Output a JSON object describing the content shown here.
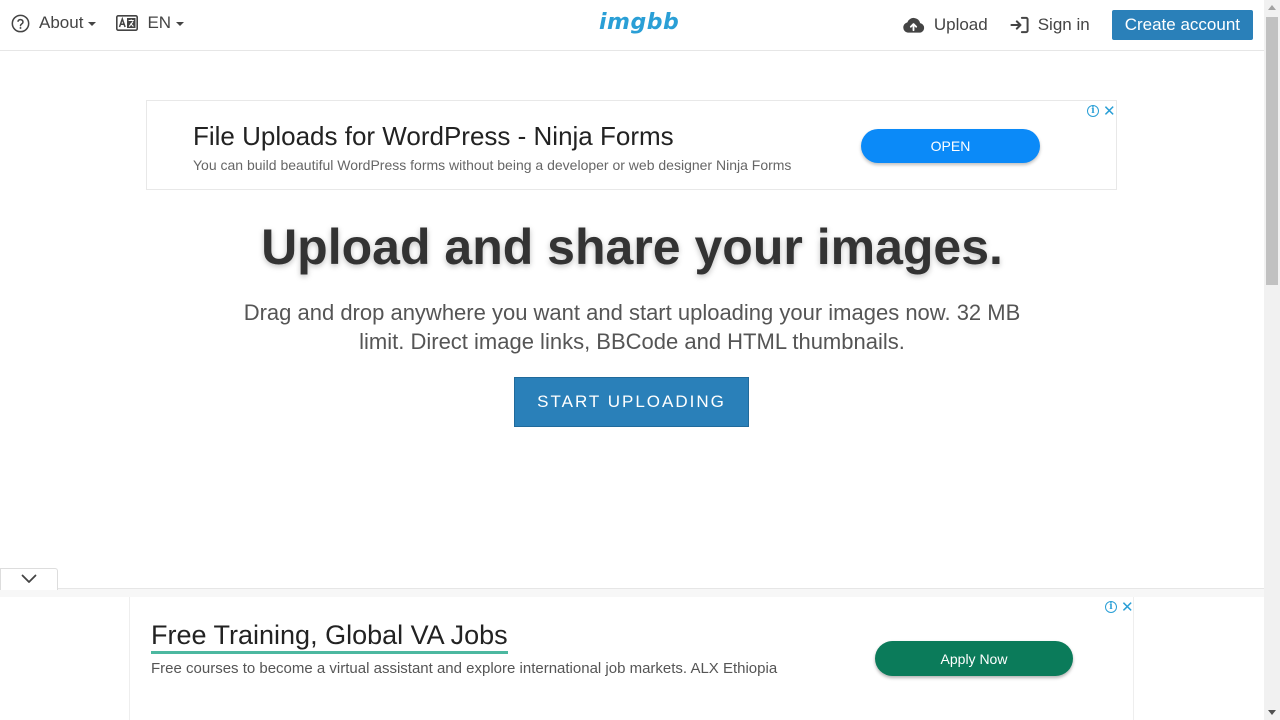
{
  "header": {
    "about_label": "About",
    "language_label": "EN",
    "logo_text": "imgbb",
    "upload_label": "Upload",
    "signin_label": "Sign in",
    "create_account_label": "Create account"
  },
  "ad_top": {
    "title": "File Uploads for WordPress - Ninja Forms",
    "description": "You can build beautiful WordPress forms without being a developer or web designer Ninja Forms",
    "cta_label": "OPEN",
    "info_glyph": "i",
    "close_glyph": "✕"
  },
  "hero": {
    "title": "Upload and share your images.",
    "description": "Drag and drop anywhere you want and start uploading your images now. 32 MB limit. Direct image links, BBCode and HTML thumbnails.",
    "start_label": "START UPLOADING"
  },
  "ad_bottom": {
    "title": "Free Training, Global VA Jobs",
    "description": "Free courses to become a virtual assistant and explore international job markets. ALX Ethiopia",
    "cta_label": "Apply Now",
    "info_glyph": "i",
    "close_glyph": "✕"
  },
  "icons": {
    "help": "question-circle-icon",
    "language": "language-card-icon",
    "upload": "cloud-upload-icon",
    "signin": "sign-in-icon",
    "collapse": "chevron-down-icon"
  },
  "colors": {
    "brand": "#2a9fd6",
    "primary_button": "#2a80b9",
    "ad_open": "#0b8af8",
    "ad_apply": "#0b7b5a"
  }
}
